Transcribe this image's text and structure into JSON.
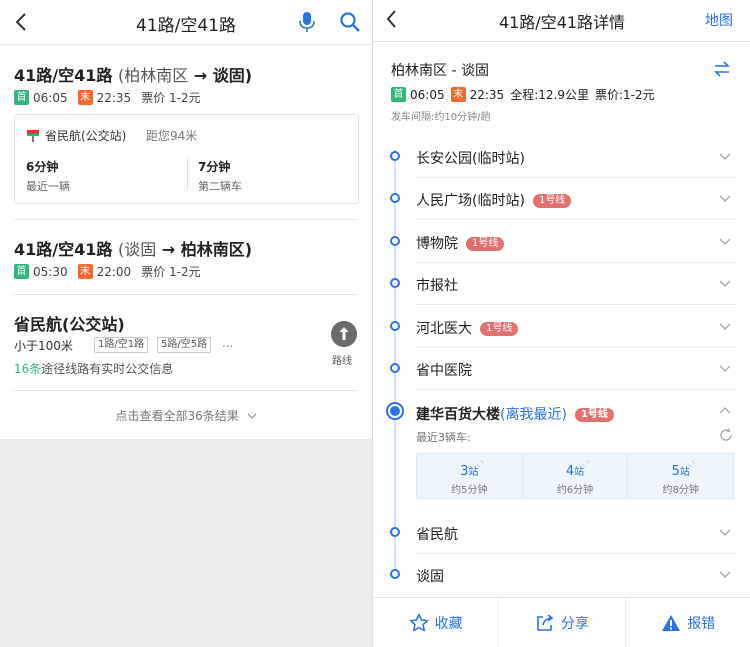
{
  "left": {
    "title": "41路/空41路",
    "route1": {
      "name": "41路/空41路",
      "from": "(柏林南区",
      "arrow": "→",
      "to": "谈固)",
      "first_tag": "首",
      "first_time": "06:05",
      "last_tag": "末",
      "last_time": "22:35",
      "price": "票价 1-2元",
      "stop": {
        "name": "省民航(公交站)",
        "distance": "距您94米",
        "bus1_min": "6分钟",
        "bus1_label": "最近一辆",
        "bus2_min": "7分钟",
        "bus2_label": "第二辆车"
      }
    },
    "route2": {
      "name": "41路/空41路",
      "from": "(谈固",
      "arrow": "→",
      "to": "柏林南区)",
      "first_tag": "首",
      "first_time": "05:30",
      "last_tag": "末",
      "last_time": "22:00",
      "price": "票价 1-2元"
    },
    "station": {
      "title": "省民航(公交站)",
      "distance": "小于100米",
      "lines": [
        "1路/空1路",
        "5路/空5路"
      ],
      "more": "...",
      "info_count": "16条",
      "info_text": "途径线路有实时公交信息",
      "route_label": "路线"
    },
    "all_results": "点击查看全部36条结果"
  },
  "right": {
    "title": "41路/空41路详情",
    "map_label": "地图",
    "route": "柏林南区 - 谈固",
    "first_tag": "首",
    "first_time": "06:05",
    "last_tag": "末",
    "last_time": "22:35",
    "distance": "全程:12.9公里",
    "price": "票价:1-2元",
    "interval": "发车间隔:约10分钟/趟",
    "stops": [
      {
        "name": "长安公园(临时站)",
        "subway": ""
      },
      {
        "name": "人民广场(临时站)",
        "subway": "1号线"
      },
      {
        "name": "博物院",
        "subway": "1号线"
      },
      {
        "name": "市报社",
        "subway": ""
      },
      {
        "name": "河北医大",
        "subway": "1号线"
      },
      {
        "name": "省中医院",
        "subway": ""
      }
    ],
    "current": {
      "name": "建华百货大楼",
      "near": "(离我最近)",
      "subway": "1号线",
      "sub_label": "最近3辆车:",
      "buses": [
        {
          "stops": "3",
          "unit": "站",
          "time": "约5分钟"
        },
        {
          "stops": "4",
          "unit": "站",
          "time": "约6分钟"
        },
        {
          "stops": "5",
          "unit": "站",
          "time": "约8分钟"
        }
      ]
    },
    "after_stops": [
      {
        "name": "省民航"
      },
      {
        "name": "谈固"
      }
    ],
    "footer": {
      "favorite": "收藏",
      "share": "分享",
      "report": "报错"
    },
    "accent": "#2a72e8",
    "subway_color": "#e27070"
  }
}
